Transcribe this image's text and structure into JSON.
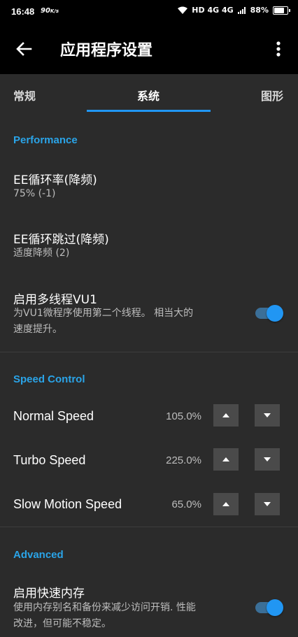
{
  "status": {
    "time": "16:48",
    "net": "90",
    "net_unit": "K/s",
    "signal": "HD 4G 4G",
    "battery": "88%"
  },
  "appbar": {
    "title": "应用程序设置"
  },
  "tabs": [
    {
      "label": "常规"
    },
    {
      "label": "系统"
    },
    {
      "label": "图形"
    }
  ],
  "performance": {
    "header": "Performance",
    "ee_cycle_rate": {
      "title": "EE循环率(降频)",
      "value": "75% (-1)"
    },
    "ee_cycle_skip": {
      "title": "EE循环跳过(降频)",
      "value": "适度降频 (2)"
    },
    "mt_vu1": {
      "title": "启用多线程VU1",
      "desc_line1": "为VU1微程序使用第二个线程。 相当大的",
      "desc_line2": "速度提升。",
      "enabled": true
    }
  },
  "speed_control": {
    "header": "Speed Control",
    "rows": [
      {
        "label": "Normal Speed",
        "value": "105.0%"
      },
      {
        "label": "Turbo Speed",
        "value": "225.0%"
      },
      {
        "label": "Slow Motion Speed",
        "value": "65.0%"
      }
    ]
  },
  "advanced": {
    "header": "Advanced",
    "fastmem": {
      "title": "启用快速内存",
      "desc_line1": "使用内存别名和备份来减少访问开销. 性能",
      "desc_line2": "改进，但可能不稳定。",
      "enabled": true
    }
  },
  "colors": {
    "accent": "#2196f3",
    "section": "#2aa4e8",
    "background": "#2b2b2b"
  }
}
